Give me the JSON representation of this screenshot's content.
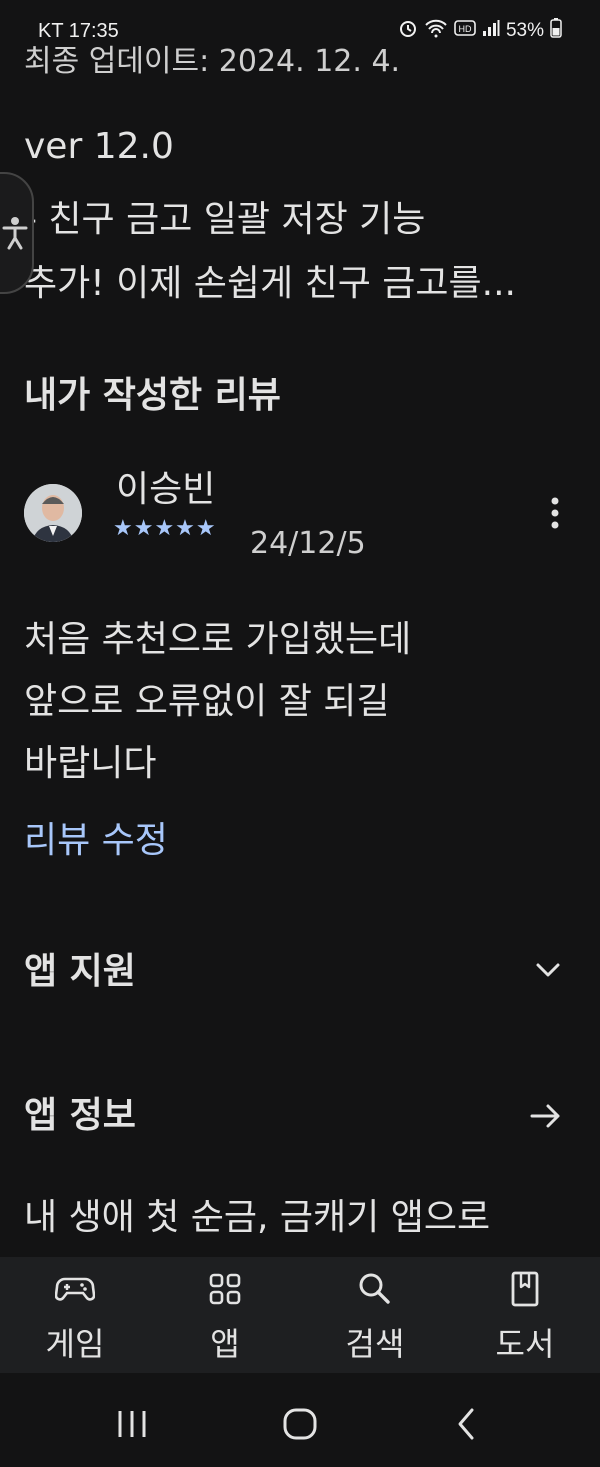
{
  "status_bar": {
    "carrier_time": "KT 17:35",
    "battery": "53%"
  },
  "whats_new": {
    "updated_clipped": "최종 업데이트: 2024. 12. 4.",
    "version": "ver 12.0",
    "line1": "- 친구 금고 일괄 저장 기능",
    "line2": "추가! 이제 손쉽게 친구 금고를..."
  },
  "my_review": {
    "section_title": "내가 작성한 리뷰",
    "reviewer_name": "이승빈",
    "stars": "★★★★★",
    "rating": 5,
    "date": "24/12/5",
    "text_lines": [
      "처음 추천으로 가입했는데",
      "앞으로 오류없이 잘 되길",
      "바랍니다"
    ],
    "edit_label": "리뷰 수정"
  },
  "app_support": {
    "title": "앱 지원"
  },
  "app_info": {
    "title": "앱 정보",
    "description_visible": "내 생애 첫 순금, 금캐기 앱으로"
  },
  "bottom_nav": {
    "items": [
      {
        "label": "게임",
        "icon": "gamepad-icon"
      },
      {
        "label": "앱",
        "icon": "apps-grid-icon"
      },
      {
        "label": "검색",
        "icon": "search-icon"
      },
      {
        "label": "도서",
        "icon": "book-icon"
      }
    ]
  },
  "colors": {
    "background": "#131314",
    "accent": "#a8c7fa",
    "text": "#e3e3e3"
  }
}
